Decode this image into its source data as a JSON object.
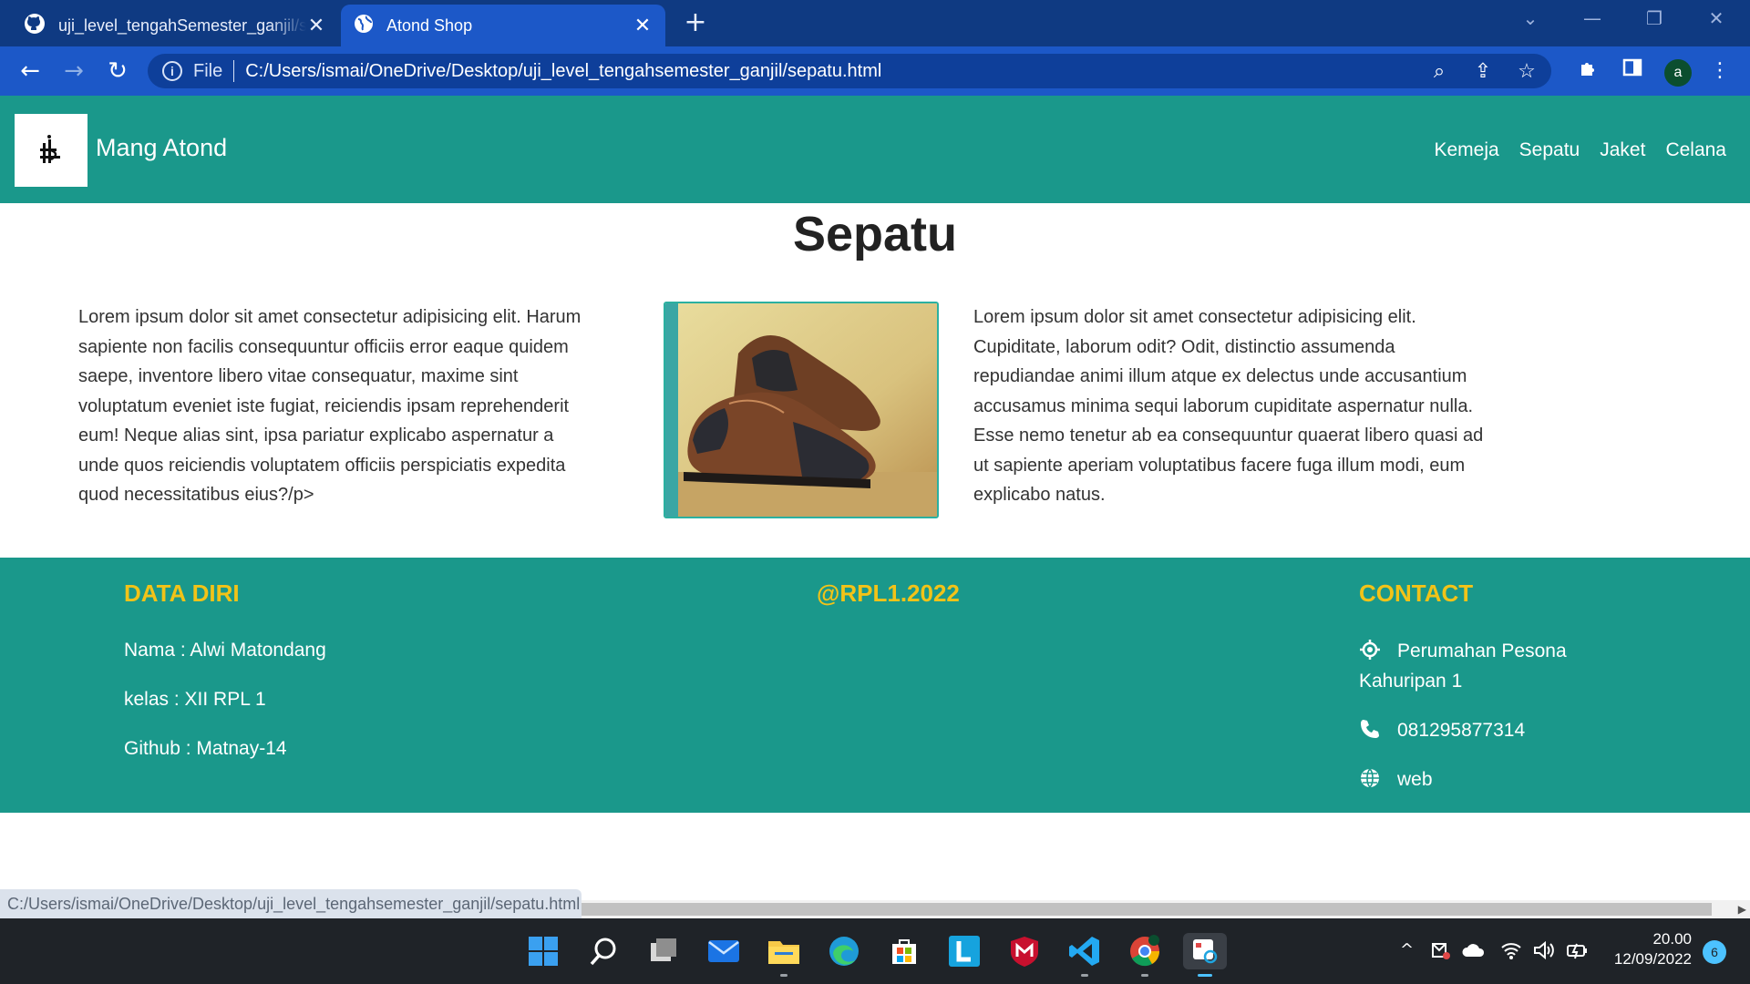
{
  "browser": {
    "tabs": [
      {
        "title": "uji_level_tengahSemester_ganjil/s",
        "icon": "github-icon",
        "active": false
      },
      {
        "title": "Atond Shop",
        "icon": "globe-icon",
        "active": true
      }
    ],
    "omnibox": {
      "scheme_label": "File",
      "url": "C:/Users/ismai/OneDrive/Desktop/uji_level_tengahsemester_ganjil/sepatu.html"
    },
    "profile_initial": "a",
    "status_url": "C:/Users/ismai/OneDrive/Desktop/uji_level_tengahsemester_ganjil/sepatu.html"
  },
  "site": {
    "brand": "Mang Atond",
    "nav": [
      "Kemeja",
      "Sepatu",
      "Jaket",
      "Celana"
    ],
    "page_title": "Sepatu",
    "left_paragraph": "Lorem ipsum dolor sit amet consectetur adipisicing elit. Harum sapiente non facilis consequuntur officiis error eaque quidem saepe, inventore libero vitae consequatur, maxime sint voluptatum eveniet iste fugiat, reiciendis ipsam reprehenderit eum! Neque alias sint, ipsa pariatur explicabo aspernatur a unde quos reiciendis voluptatem officiis perspiciatis expedita quod necessitatibus eius?/p>",
    "right_paragraph": "Lorem ipsum dolor sit amet consectetur adipisicing elit. Cupiditate, laborum odit? Odit, distinctio assumenda repudiandae animi illum atque ex delectus unde accusantium accusamus minima sequi laborum cupiditate aspernatur nulla. Esse nemo tenetur ab ea consequuntur quaerat libero quasi ad ut sapiente aperiam voluptatibus facere fuga illum modi, eum explicabo natus.",
    "footer": {
      "data_diri": {
        "heading": "DATA DIRI",
        "nama": "Nama : Alwi Matondang",
        "kelas": "kelas : XII RPL 1",
        "github": "Github : Matnay-14"
      },
      "center_heading": "@RPL1.2022",
      "contact": {
        "heading": "CONTACT",
        "address": "Perumahan Pesona Kahuripan 1",
        "phone": "081295877314",
        "web": "web"
      }
    }
  },
  "taskbar": {
    "time": "20.00",
    "date": "12/09/2022",
    "notification_count": "6"
  },
  "colors": {
    "teal": "#1a988b",
    "footer_heading": "#f2c318",
    "chrome_blue": "#1c58c8"
  }
}
